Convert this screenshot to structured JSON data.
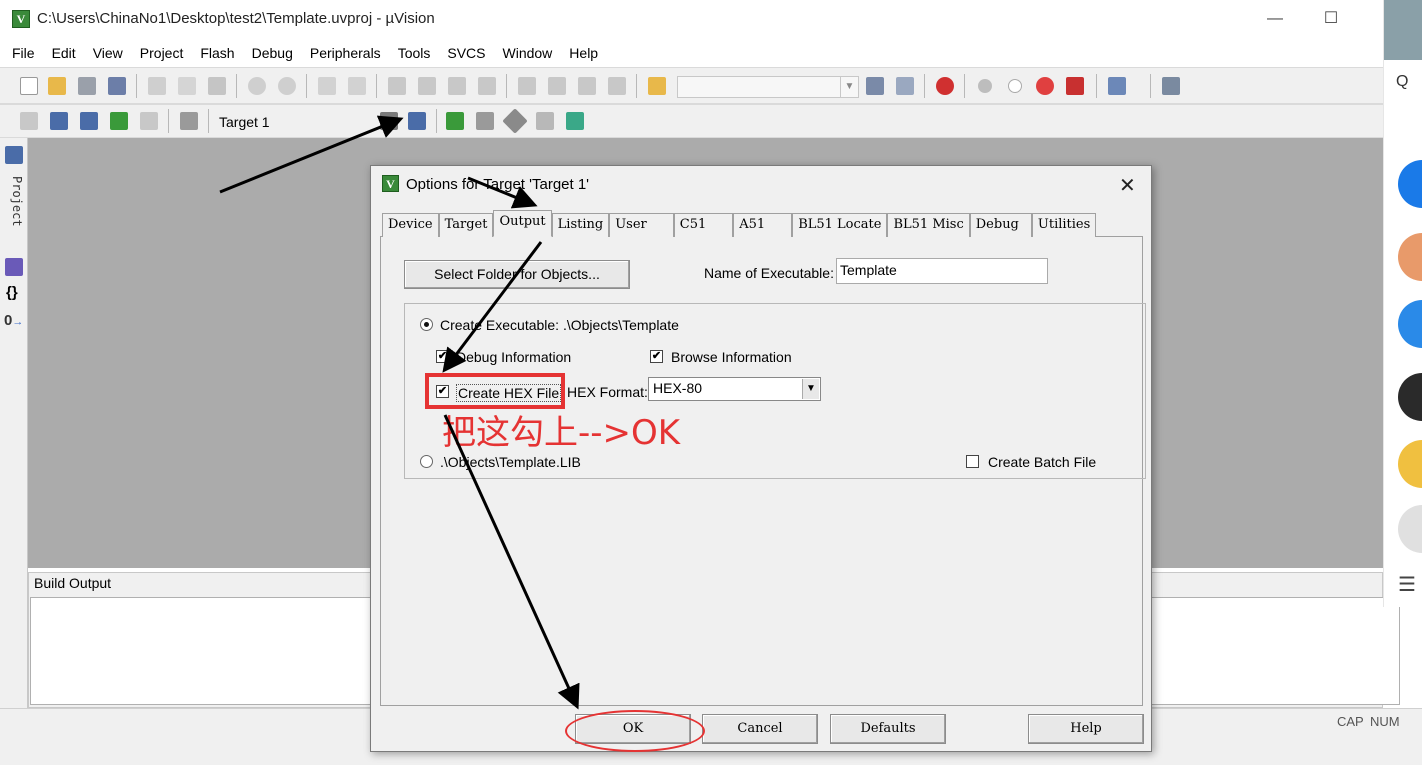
{
  "window": {
    "title": "C:\\Users\\ChinaNo1\\Desktop\\test2\\Template.uvproj - µVision",
    "app_icon_letter": "V"
  },
  "menu": [
    "File",
    "Edit",
    "View",
    "Project",
    "Flash",
    "Debug",
    "Peripherals",
    "Tools",
    "SVCS",
    "Window",
    "Help"
  ],
  "toolbar": {
    "target_name": "Target 1"
  },
  "left_pane": {
    "project_label": "Project"
  },
  "build_output": {
    "title": "Build Output"
  },
  "status_bar": {
    "cap": "CAP",
    "num": "NUM"
  },
  "dialog": {
    "title": "Options for Target 'Target 1'",
    "close_glyph": "✕",
    "tabs": [
      "Device",
      "Target",
      "Output",
      "Listing",
      "User",
      "C51",
      "A51",
      "BL51 Locate",
      "BL51 Misc",
      "Debug",
      "Utilities"
    ],
    "active_tab": "Output",
    "select_folder_label": "Select Folder for Objects...",
    "name_of_executable_label": "Name of Executable:",
    "name_of_executable_value": "Template",
    "create_executable_label": "Create Executable:  .\\Objects\\Template",
    "debug_information_label": "Debug Information",
    "browse_information_label": "Browse Information",
    "create_hex_label": "Create HEX File",
    "hex_format_label": "HEX Format:",
    "hex_format_value": "HEX-80",
    "library_label": ".\\Objects\\Template.LIB",
    "create_batch_label": "Create Batch File",
    "buttons": {
      "ok": "OK",
      "cancel": "Cancel",
      "defaults": "Defaults",
      "help": "Help"
    },
    "state": {
      "create_executable": true,
      "debug_information": true,
      "browse_information": true,
      "create_hex": true,
      "create_library": false,
      "create_batch": false
    }
  },
  "annotation": {
    "text": "把这勾上-->OK",
    "color": "#e53333"
  },
  "colors": {
    "workspace": "#ababab",
    "panel": "#f0f0f0",
    "annotation_red": "#e53333"
  }
}
